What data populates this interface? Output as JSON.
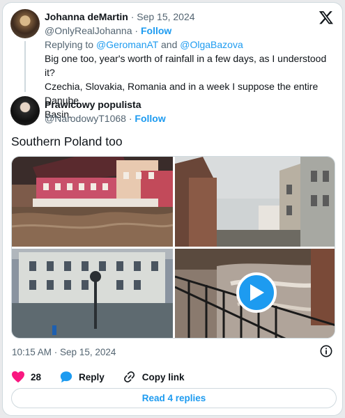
{
  "first_post": {
    "author_name": "Johanna deMartin",
    "date": "· Sep 15, 2024",
    "handle": "@OnlyRealJohanna",
    "separator": "·",
    "follow_label": "Follow",
    "replying_prefix": "Replying to",
    "reply_to_1": "@GeromanAT",
    "reply_and": "and",
    "reply_to_2": "@OlgaBazova",
    "text_line_1": "Big one too, year's worth of rainfall in a few days, as I understood it?",
    "text_line_2": "Czechia, Slovakia, Romania and in a week I suppose the entire Danube",
    "text_line_3": "Basin."
  },
  "second_post": {
    "author_name": "Prawicowy populista",
    "handle": "@NarodowyT1068",
    "separator": "·",
    "follow_label": "Follow",
    "text": "Southern Poland too",
    "media_icons": [
      "flood-photo-1",
      "flood-photo-2",
      "flood-photo-3",
      "flood-video-thumbnail",
      "play-icon"
    ],
    "timestamp": "10:15 AM · Sep 15, 2024",
    "like_count": "28",
    "reply_label": "Reply",
    "copy_link_label": "Copy link",
    "read_replies_label": "Read 4 replies"
  },
  "colors": {
    "accent": "#1d9bf0",
    "like": "#f91880",
    "muted": "#536471",
    "text": "#0f1419"
  }
}
